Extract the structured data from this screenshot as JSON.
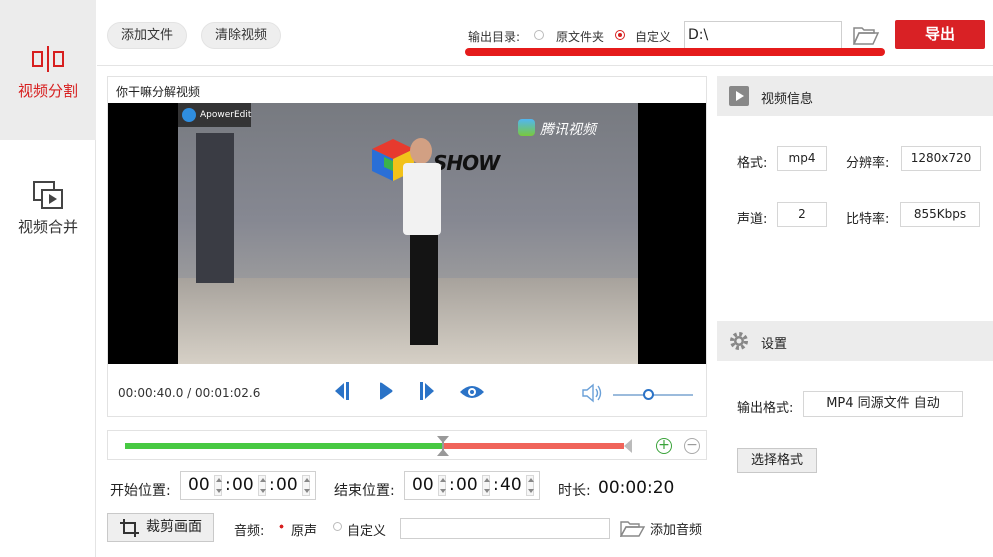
{
  "sidebar": {
    "items": [
      {
        "label": "视频分割",
        "icon": "split-icon",
        "active": true
      },
      {
        "label": "视频合并",
        "icon": "merge-icon",
        "active": false
      }
    ]
  },
  "toolbar": {
    "add_file": "添加文件",
    "clear_video": "清除视频",
    "output_dir_label": "输出目录:",
    "option_source": "原文件夹",
    "option_custom": "自定义",
    "dir_value": "D:\\",
    "export_label": "导出"
  },
  "player": {
    "title": "你干嘛分解视频",
    "watermark_tencent": "腾讯视频",
    "watermark_apower": "ApowerEdit",
    "stage_logo": "SHOW",
    "time_display": "00:00:40.0 / 00:01:02.6",
    "volume_level": 0.45
  },
  "timeline": {
    "progress_fraction": 0.638,
    "zoom_in": "+",
    "zoom_out": "−"
  },
  "trim": {
    "start_label": "开始位置:",
    "start": {
      "h": "00",
      "m": "00",
      "s": "00"
    },
    "end_label": "结束位置:",
    "end": {
      "h": "00",
      "m": "00",
      "s": "40"
    },
    "duration_label": "时长:",
    "duration": "00:00:20"
  },
  "bottom": {
    "crop_label": "裁剪画面",
    "audio_label": "音频:",
    "audio_original": "原声",
    "audio_custom": "自定义",
    "add_audio": "添加音频"
  },
  "info": {
    "header": "视频信息",
    "format_label": "格式:",
    "format_value": "mp4",
    "resolution_label": "分辨率:",
    "resolution_value": "1280x720",
    "channels_label": "声道:",
    "channels_value": "2",
    "bitrate_label": "比特率:",
    "bitrate_value": "855Kbps"
  },
  "settings": {
    "header": "设置",
    "output_format_label": "输出格式:",
    "output_format_value": "MP4 同源文件 自动",
    "choose_format": "选择格式"
  },
  "colors": {
    "accent_red": "#d92125",
    "timeline_green": "#47c942",
    "timeline_red": "#f0645a",
    "control_blue": "#2b73c7"
  }
}
